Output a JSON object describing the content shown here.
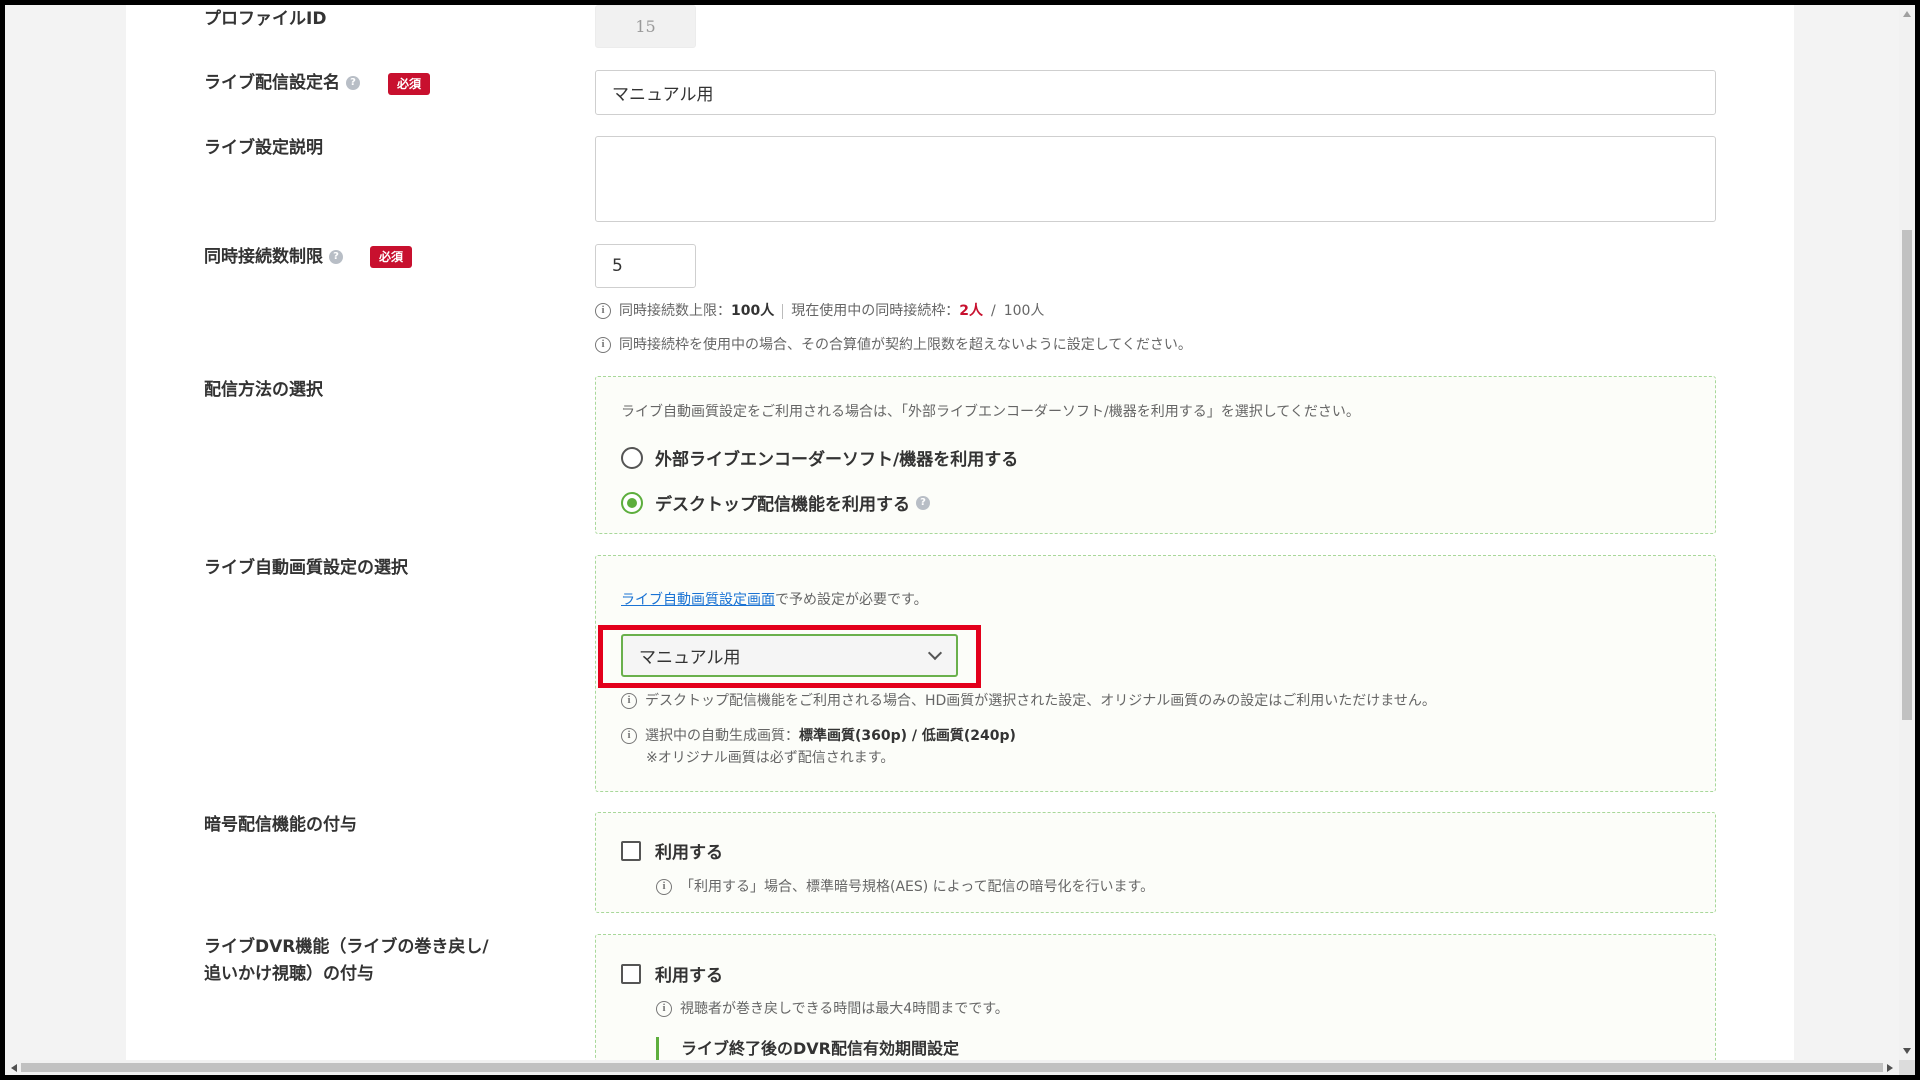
{
  "form": {
    "profile_id": {
      "label": "プロファイルID",
      "value": "15"
    },
    "stream_name": {
      "label": "ライブ配信設定名",
      "required": "必須",
      "value": "マニュアル用"
    },
    "description": {
      "label": "ライブ設定説明",
      "value": ""
    },
    "concurrent": {
      "label": "同時接続数制限",
      "required": "必須",
      "value": "5",
      "note1_prefix": "同時接続数上限：",
      "note1_limit": "100人",
      "note1_mid": "現在使用中の同時接続枠：",
      "note1_used": "2人",
      "note1_slash": "/",
      "note1_total": "100人",
      "note2": "同時接続枠を使用中の場合、その合算値が契約上限数を超えないように設定してください。"
    },
    "method": {
      "label": "配信方法の選択",
      "hint": "ライブ自動画質設定をご利用される場合は、「外部ライブエンコーダーソフト/機器を利用する」を選択してください。",
      "option1": "外部ライブエンコーダーソフト/機器を利用する",
      "option2": "デスクトップ配信機能を利用する",
      "selected": "option2"
    },
    "auto_quality": {
      "label": "ライブ自動画質設定の選択",
      "link": "ライブ自動画質設定画面",
      "link_suffix": "で予め設定が必要です。",
      "selected": "マニュアル用",
      "note1": "デスクトップ配信機能をご利用される場合、HD画質が選択された設定、オリジナル画質のみの設定はご利用いただけません。",
      "note2_prefix": "選択中の自動生成画質：",
      "note2_value": "標準画質(360p) / 低画質(240p)",
      "note3": "※オリジナル画質は必ず配信されます。"
    },
    "encryption": {
      "label": "暗号配信機能の付与",
      "checkbox": "利用する",
      "note": "「利用する」場合、標準暗号規格(AES) によって配信の暗号化を行います。"
    },
    "dvr": {
      "label_line1": "ライブDVR機能（ライブの巻き戻し/",
      "label_line2": "追いかけ視聴）の付与",
      "checkbox": "利用する",
      "note": "視聴者が巻き戻しできる時間は最大4時間までです。",
      "subheading": "ライブ終了後のDVR配信有効期間設定"
    }
  },
  "colors": {
    "required_badge": "#c8102e",
    "accent_green": "#5dae3d",
    "highlight_red": "#e3001b",
    "link_blue": "#1a73d4"
  }
}
